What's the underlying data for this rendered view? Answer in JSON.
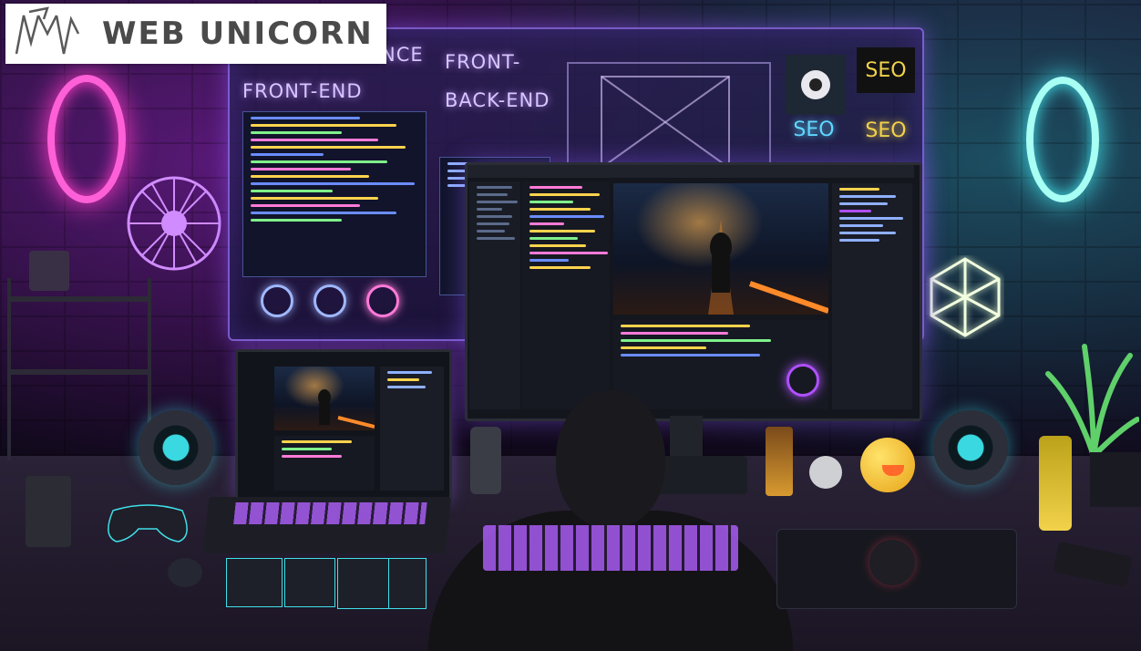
{
  "logo": {
    "text": "WEB UNICORN",
    "mark": "unicorn-wv-logo"
  },
  "wall_screen": {
    "label_partial": "NCE",
    "label_front_end": "FRONT-END",
    "label_front_dash": "FRONT-",
    "label_back_end": "BACK-END",
    "seo_labels": [
      "SEO",
      "SEO",
      "SEO"
    ]
  },
  "colors": {
    "neon_purple": "#b050ff",
    "neon_cyan": "#40e0e8",
    "neon_pink": "#ff3cc8",
    "seo_yellow": "#f2d24a"
  },
  "icons": [
    "unicorn-logo-icon",
    "wall-fan-icon",
    "ring-light-icon",
    "geometric-lamp-icon",
    "gamepad-icon",
    "plant-icon",
    "play-button-icon"
  ]
}
